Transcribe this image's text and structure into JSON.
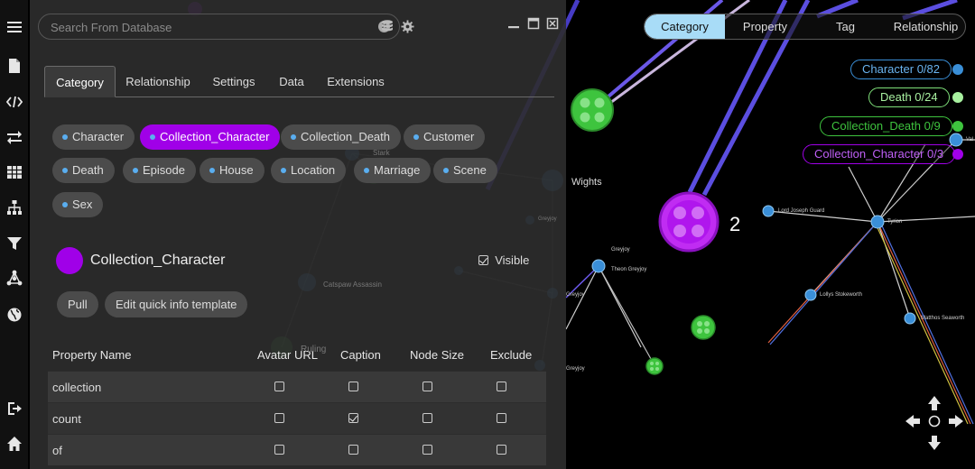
{
  "sidebar": {
    "icons": [
      "menu-icon",
      "document-icon",
      "code-icon",
      "swap-icon",
      "table-icon",
      "hierarchy-icon",
      "filter-icon",
      "network-icon",
      "globe-icon",
      "logout-icon",
      "home-icon"
    ]
  },
  "search": {
    "placeholder": "Search From Database",
    "value": ""
  },
  "panel": {
    "tabs": [
      "Category",
      "Relationship",
      "Settings",
      "Data",
      "Extensions"
    ],
    "active_tab": "Category",
    "categories": [
      "Character",
      "Collection_Character",
      "Collection_Death",
      "Customer",
      "Death",
      "Episode",
      "House",
      "Location",
      "Marriage",
      "Scene",
      "Sex"
    ],
    "active_category": "Collection_Character",
    "selected": {
      "name": "Collection_Character",
      "color": "#a000e8",
      "visible_label": "Visible",
      "visible": true
    },
    "buttons": {
      "pull": "Pull",
      "edit_template": "Edit quick info template"
    },
    "table": {
      "headers": [
        "Property Name",
        "Avatar URL",
        "Caption",
        "Node Size",
        "Exclude"
      ],
      "rows": [
        {
          "name": "collection",
          "avatar": false,
          "caption": false,
          "size": false,
          "exclude": false
        },
        {
          "name": "count",
          "avatar": false,
          "caption": true,
          "size": false,
          "exclude": false
        },
        {
          "name": "of",
          "avatar": false,
          "caption": false,
          "size": false,
          "exclude": false
        }
      ]
    }
  },
  "graph": {
    "view_tabs": [
      "Category",
      "Property",
      "Tag",
      "Relationship"
    ],
    "active_view_tab": "Category",
    "legend": [
      {
        "label": "Character 0/82",
        "color": "#3a8fd8"
      },
      {
        "label": "Death 0/24",
        "color": "#7fe07a"
      },
      {
        "label": "Collection_Death 0/9",
        "color": "#3ec43e"
      },
      {
        "label": "Collection_Character 0/3",
        "color": "#a000e8"
      }
    ],
    "node_label_wights": "Wights",
    "node_count_label": "2",
    "small_labels": [
      "Greyjoy",
      "Theon Greyjoy",
      "Lollys Stokeworth",
      "Matthos Seaworth",
      "Lord Joseph Guard",
      "Tyrion",
      "Greyjoy",
      "Greyjoy",
      "Val"
    ],
    "background_labels": [
      "Stark",
      "Catspaw Assassin",
      "Ruling",
      "Greyjoy"
    ],
    "nav_icons": [
      "arrow-up-icon",
      "arrow-down-icon",
      "arrow-left-icon",
      "arrow-right-icon",
      "center-icon"
    ]
  }
}
